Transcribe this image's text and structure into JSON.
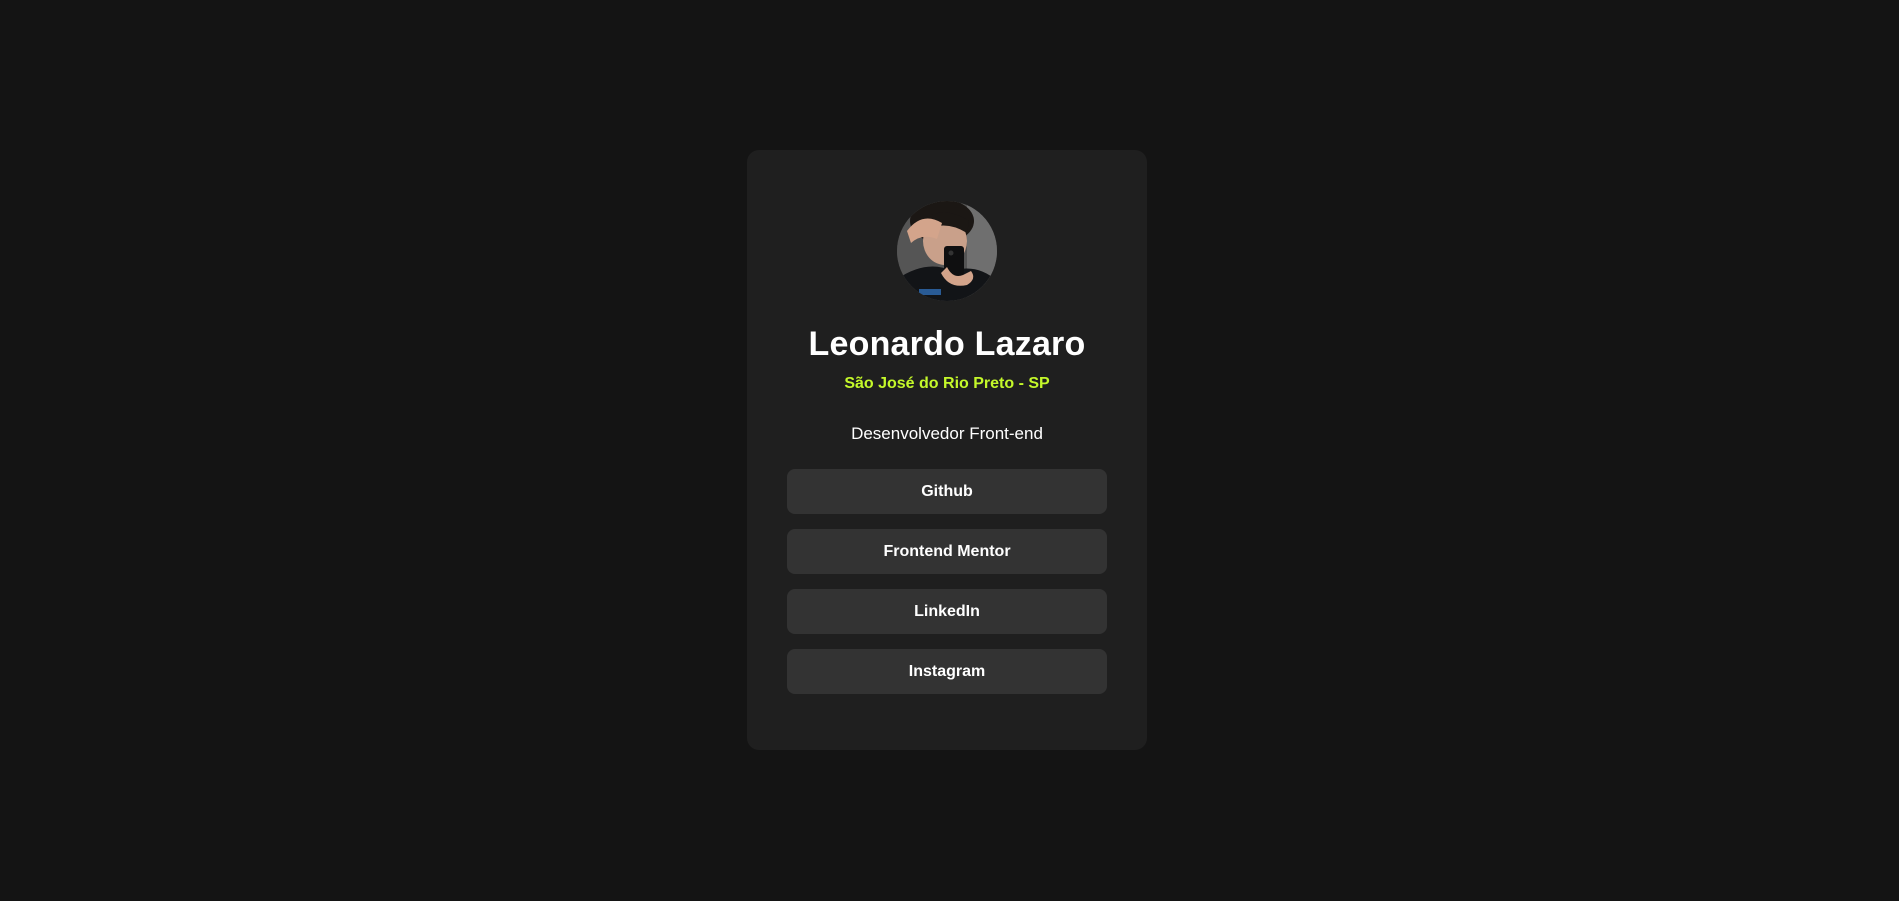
{
  "profile": {
    "name": "Leonardo Lazaro",
    "location": "São José do Rio Preto - SP",
    "bio": "Desenvolvedor Front-end",
    "avatar_icon": "avatar-photo"
  },
  "links": [
    {
      "label": "Github"
    },
    {
      "label": "Frontend Mentor"
    },
    {
      "label": "LinkedIn"
    },
    {
      "label": "Instagram"
    }
  ],
  "colors": {
    "background": "#141414",
    "card": "#1f1f1f",
    "button": "#333333",
    "accent": "#c4f82a",
    "text": "#ffffff"
  }
}
